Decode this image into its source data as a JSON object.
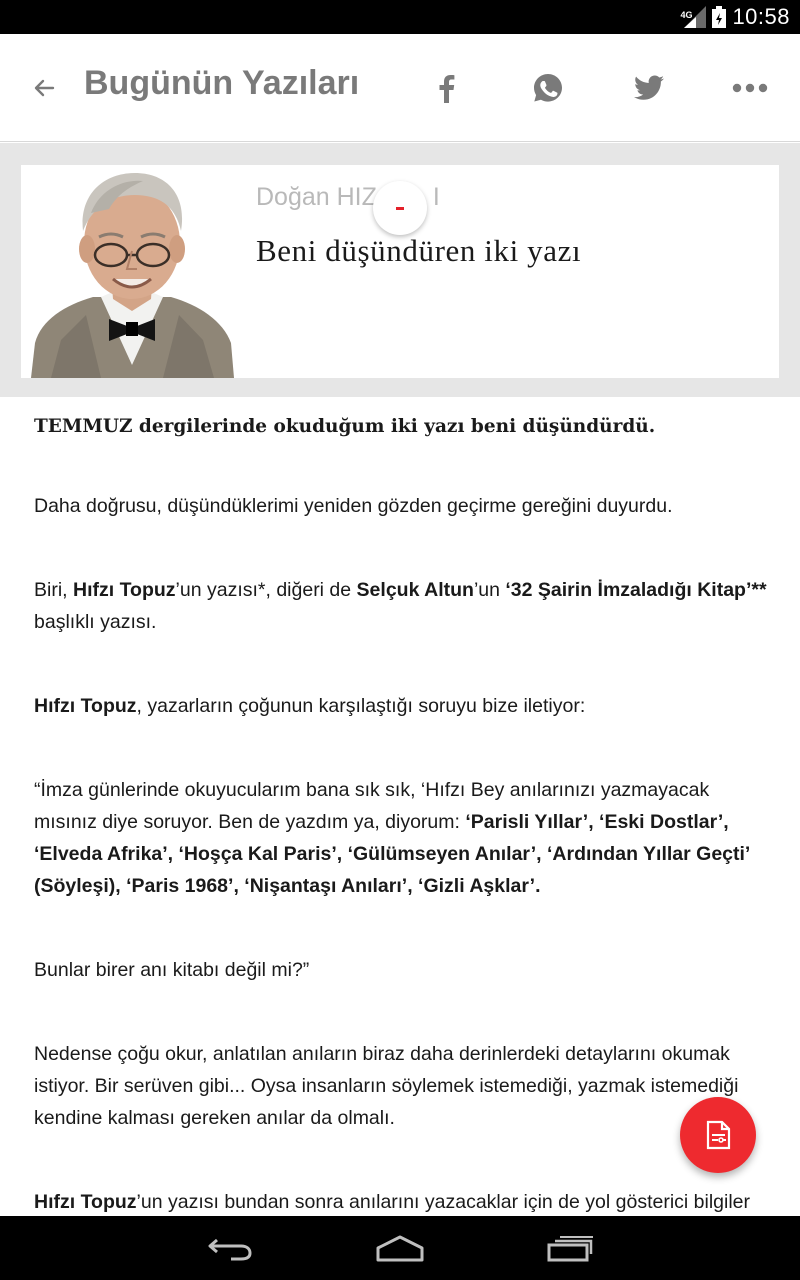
{
  "status_bar": {
    "network": "4G",
    "time": "10:58"
  },
  "app_bar": {
    "title": "Bugünün Yazıları",
    "icons": [
      "back-arrow-icon",
      "facebook-icon",
      "whatsapp-icon",
      "twitter-icon",
      "more-icon"
    ]
  },
  "header": {
    "author": "Doğan HIZ",
    "author_suffix": "I",
    "title": "Beni düşündüren iki yazı"
  },
  "article": {
    "lead": "TEMMUZ dergilerinde okuduğum iki yazı beni düşündürdü.",
    "p1": "Daha doğrusu, düşündüklerimi yeniden gözden geçirme gereğini duyurdu.",
    "p2": {
      "t1": "Biri, ",
      "b1": "Hıfzı Topuz",
      "t2": "’un yazısı*, diğeri de ",
      "b2": "Selçuk Altun",
      "t3": "’un ",
      "b3": "‘32 Şairin İmzaladığı Kitap’**",
      "t4": " başlıklı yazısı."
    },
    "p3": {
      "b1": "Hıfzı Topuz",
      "t1": ", yazarların çoğunun karşılaştığı soruyu bize iletiyor:"
    },
    "p4": {
      "t1": "“İmza günlerinde okuyucularım bana sık sık, ‘Hıfzı Bey anılarınızı yazmayacak mısınız diye soruyor. Ben de yazdım ya, diyorum: ",
      "b1": "‘Parisli Yıllar’, ‘Eski Dostlar’, ‘Elveda Afrika’, ‘Hoşça Kal Paris’, ‘Gülümseyen Anılar’, ‘Ardından Yıllar Geçti’ (Söyleşi), ‘Paris 1968’, ‘Nişantaşı Anıları’, ‘Gizli Aşklar’."
    },
    "p5": "Bunlar birer anı kitabı değil mi?”",
    "p6": "Nedense çoğu okur, anlatılan anıların biraz daha derinlerdeki detaylarını okumak istiyor. Bir serüven gibi... Oysa insanların söylemek istemediği, yazmak istemediği kendine kalması gereken anılar da olmalı.",
    "p7": {
      "b1": "Hıfzı Topuz",
      "t1": "’un yazısı bundan sonra anılarını yazacaklar için de yol gösterici bilgiler"
    }
  },
  "fab": {
    "icon": "article-icon",
    "color": "#ee2a2f"
  },
  "nav_bar": {
    "icons": [
      "nav-back-icon",
      "nav-home-icon",
      "nav-recent-apps-icon"
    ]
  },
  "colors": {
    "accent": "#ee2a2f",
    "title_gray": "#7a7a7a",
    "band": "#e6e6e6"
  }
}
